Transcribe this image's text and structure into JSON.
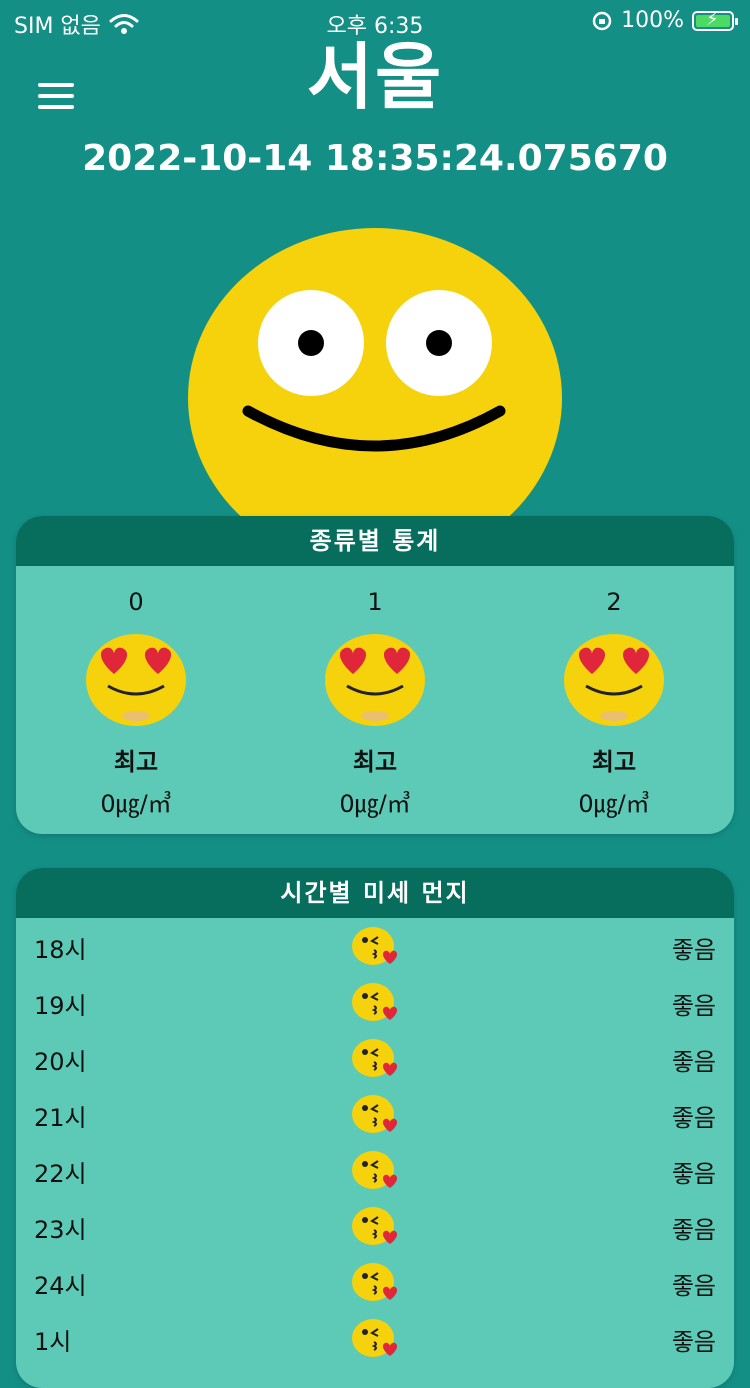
{
  "status_bar": {
    "carrier": "SIM 없음",
    "time": "오후 6:35",
    "battery": "100%"
  },
  "header": {
    "city": "서울",
    "datetime": "2022-10-14 18:35:24.075670"
  },
  "stats_card": {
    "title": "종류별 통계",
    "items": [
      {
        "index": "0",
        "grade": "최고",
        "value": "0㎍/㎥"
      },
      {
        "index": "1",
        "grade": "최고",
        "value": "0㎍/㎥"
      },
      {
        "index": "2",
        "grade": "최고",
        "value": "0㎍/㎥"
      }
    ]
  },
  "hourly_card": {
    "title": "시간별 미세 먼지",
    "rows": [
      {
        "hour": "18시",
        "status": "좋음"
      },
      {
        "hour": "19시",
        "status": "좋음"
      },
      {
        "hour": "20시",
        "status": "좋음"
      },
      {
        "hour": "21시",
        "status": "좋음"
      },
      {
        "hour": "22시",
        "status": "좋음"
      },
      {
        "hour": "23시",
        "status": "좋음"
      },
      {
        "hour": "24시",
        "status": "좋음"
      },
      {
        "hour": "1시",
        "status": "좋음"
      }
    ]
  },
  "colors": {
    "background": "#138f86",
    "card": "#5ccab7",
    "card_header": "#076d5c",
    "face": "#f6d20c"
  },
  "icons": {
    "menu": "hamburger-icon",
    "face": "smiley-icon",
    "heart_eyes": "heart-eyes-emoji-icon",
    "kiss": "kissing-emoji-icon"
  }
}
